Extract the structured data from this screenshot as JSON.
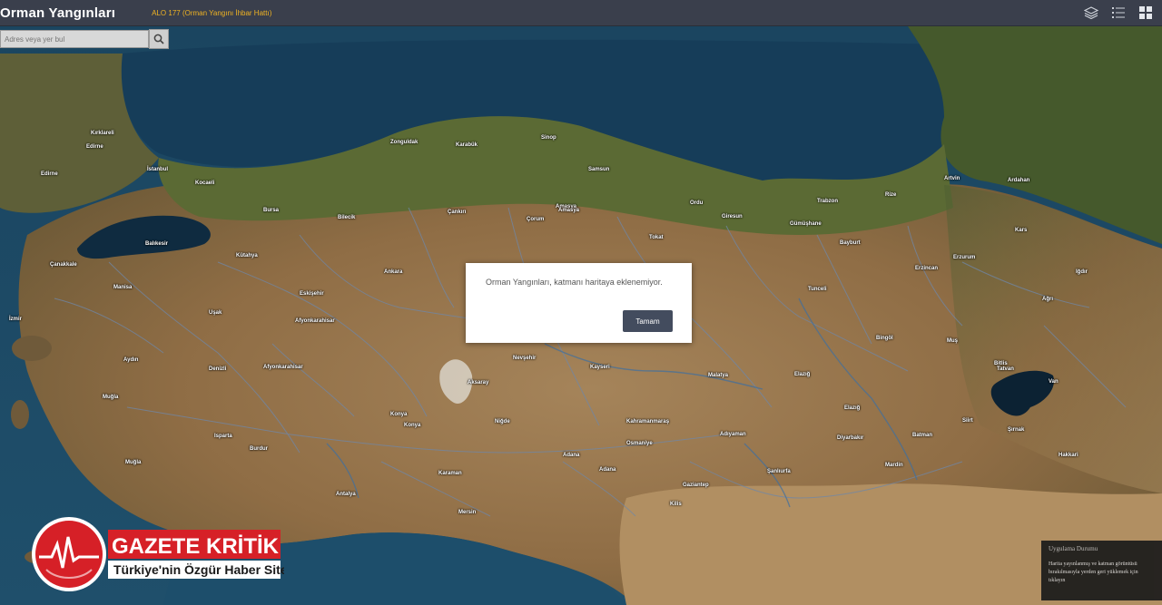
{
  "header": {
    "app_title": "Orman Yangınları",
    "hotline": "ALO 177 (Orman Yangını İhbar Hattı)",
    "icons": [
      "layers-icon",
      "legend-list-icon",
      "basemap-gallery-icon"
    ]
  },
  "search": {
    "placeholder": "Adres veya yer bul",
    "button_icon": "search-icon"
  },
  "dialog": {
    "message": "Orman Yangınları, katmanı haritaya eklenemiyor.",
    "ok_label": "Tamam"
  },
  "status_panel": {
    "title": "Uygulama Durumu",
    "line1": "Harita yayınlanmış ve katman görüntüsü",
    "line2": "bırakılmasıyla yerden geri yüklemek için",
    "line3": "tıklayın"
  },
  "watermark": {
    "brand": "GAZETE KRİTİK",
    "tagline": "Türkiye'nin Özgür Haber Sitesi"
  },
  "colors": {
    "topbar": "#3a3f4c",
    "accent_orange": "#f0b323",
    "sea": "#1f4a66",
    "land": "#8a6a44",
    "button": "#434c5e",
    "logo_red": "#d62027"
  }
}
